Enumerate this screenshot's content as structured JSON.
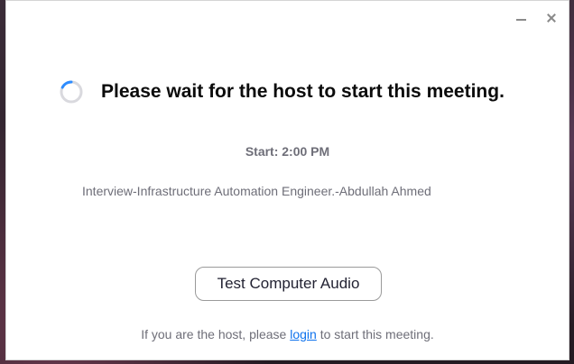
{
  "window": {
    "minimize_icon": "minimize-icon",
    "close_icon": "close-icon"
  },
  "waiting": {
    "spinner_icon": "loading-spinner-icon",
    "heading": "Please wait for the host to start this meeting.",
    "start_time": "Start: 2:00 PM",
    "meeting_title": "Interview-Infrastructure Automation Engineer.-Abdullah Ahmed"
  },
  "actions": {
    "test_audio_label": "Test Computer Audio"
  },
  "footer": {
    "prefix": "If you are the host, please ",
    "login_link": "login",
    "suffix": " to start this meeting."
  },
  "colors": {
    "accent": "#0e72ed",
    "spinner_arc": "#2d8cff",
    "text_muted": "#6e6e78",
    "heading": "#0b0b0b"
  }
}
